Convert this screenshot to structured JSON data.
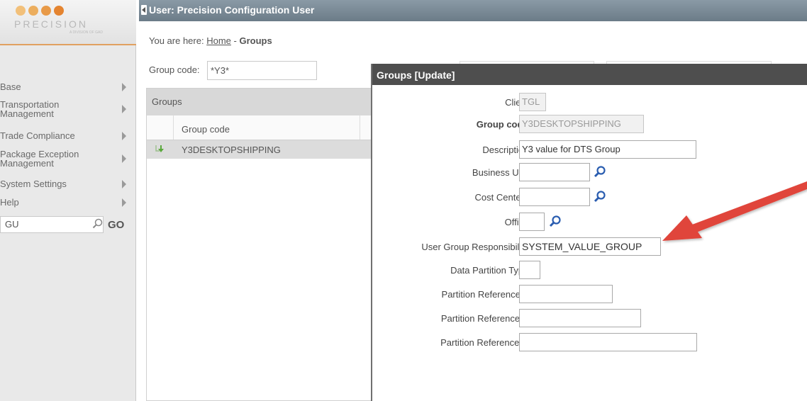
{
  "logo": {
    "name": "PRECISION",
    "tagline": "A DIVISION OF GAD",
    "dot_colors": [
      "#f2c07a",
      "#ecae5e",
      "#e89a48",
      "#e48430"
    ]
  },
  "sidebar": {
    "items": [
      {
        "label": "Base"
      },
      {
        "label": "Transportation Management"
      },
      {
        "label": "Trade Compliance"
      },
      {
        "label": "Package Exception Management"
      },
      {
        "label": "System Settings"
      },
      {
        "label": "Help"
      }
    ],
    "search_value": "GU",
    "go_label": "GO"
  },
  "topbar": {
    "title": "User: Precision Configuration User"
  },
  "breadcrumb": {
    "prefix": "You are here:",
    "home": "Home",
    "separator": "-",
    "current": "Groups"
  },
  "filter": {
    "label": "Group code:",
    "value": "*Y3*"
  },
  "groups_panel": {
    "title": "Groups",
    "column_header": "Group code",
    "rows": [
      {
        "group_code": "Y3DESKTOPSHIPPING"
      }
    ]
  },
  "modal": {
    "title": "Groups [Update]",
    "fields": {
      "client": {
        "label": "Client:",
        "value": "TGL"
      },
      "group_code": {
        "label": "Group code:",
        "value": "Y3DESKTOPSHIPPING"
      },
      "description": {
        "label": "Description:",
        "value": "Y3 value for DTS Group"
      },
      "business_unit": {
        "label": "Business Unit:",
        "value": ""
      },
      "cost_centers": {
        "label": "Cost Centers:",
        "value": ""
      },
      "office": {
        "label": "Office:",
        "value": ""
      },
      "user_group_responsibility": {
        "label": "User Group Responsibility:",
        "value": "SYSTEM_VALUE_GROUP"
      },
      "data_partition_type": {
        "label": "Data Partition Type:",
        "value": ""
      },
      "partition_reference_a": {
        "label": "Partition Reference A:",
        "value": ""
      },
      "partition_reference_b": {
        "label": "Partition Reference B:",
        "value": ""
      },
      "partition_reference_c": {
        "label": "Partition Reference C:",
        "value": ""
      }
    }
  },
  "colors": {
    "topbar": "#7a8a96",
    "modal_header": "#4e4e4e",
    "annotation_arrow": "#e0443a",
    "lookup_icon": "#2a5db0",
    "row_icon": "#5aa83c"
  }
}
